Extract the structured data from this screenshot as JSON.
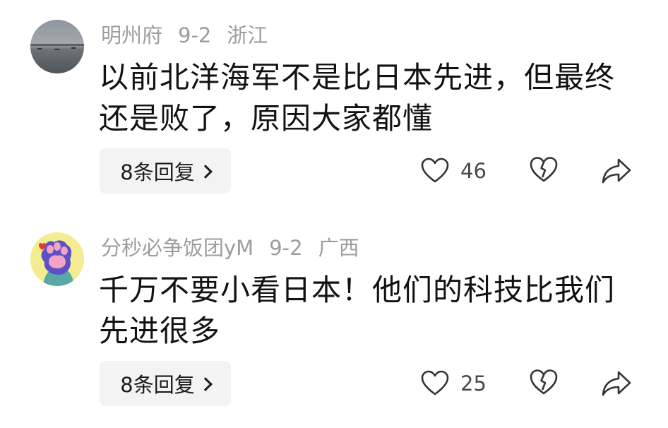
{
  "comments": [
    {
      "username": "明州府",
      "date": "9-2",
      "location": "浙江",
      "text": "以前北洋海军不是比日本先进，但最终还是败了，原因大家都懂",
      "reply_label": "8条回复",
      "likes": "46",
      "avatar_icon": "lake-photo-avatar"
    },
    {
      "username": "分秒必争饭团yM",
      "date": "9-2",
      "location": "广西",
      "text": "千万不要小看日本！他们的科技比我们先进很多",
      "reply_label": "8条回复",
      "likes": "25",
      "avatar_icon": "cat-paw-avatar"
    }
  ]
}
